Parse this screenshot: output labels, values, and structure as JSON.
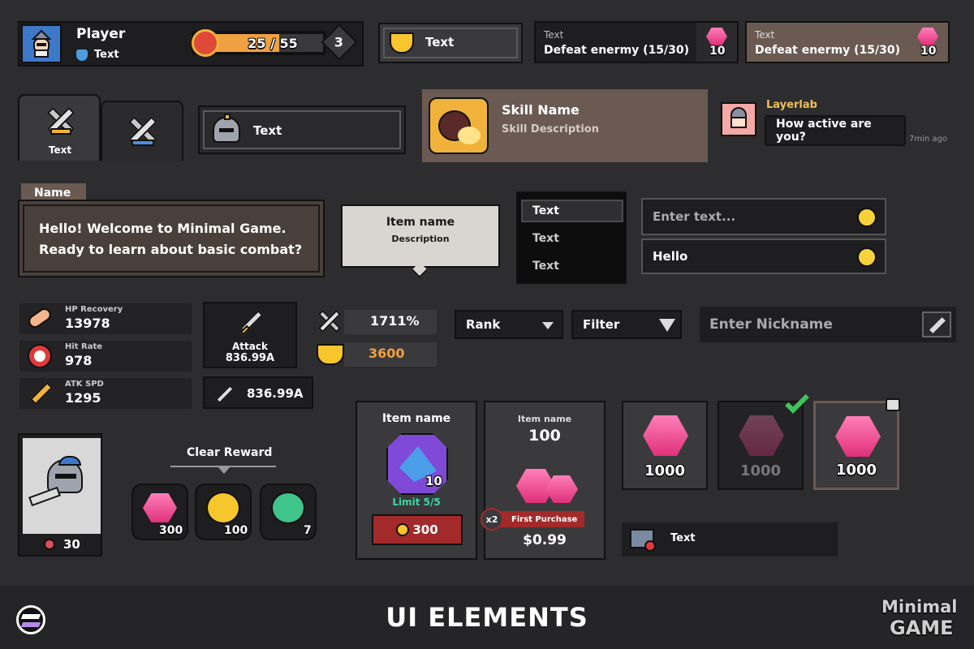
{
  "profile": {
    "name": "Player",
    "sub": "Text",
    "xp": "25 / 55",
    "level": "3"
  },
  "trophy_button": {
    "label": "Text"
  },
  "quest1": {
    "title": "Text",
    "desc": "Defeat enermy (15/30)",
    "reward": "10"
  },
  "quest2": {
    "title": "Text",
    "desc": "Defeat enermy (15/30)",
    "reward": "10"
  },
  "tabs": [
    {
      "label": "Text"
    },
    {
      "label": ""
    }
  ],
  "helmet_button": {
    "label": "Text"
  },
  "skill": {
    "name": "Skill Name",
    "desc": "Skill Description"
  },
  "chat": {
    "user": "Layerlab",
    "message": "How active are you?",
    "time": "7min ago"
  },
  "dialog": {
    "name": "Name",
    "line1": "Hello! Welcome to Minimal Game.",
    "line2": "Ready to learn about basic combat?"
  },
  "tooltip": {
    "title": "Item name",
    "desc": "Description"
  },
  "list": {
    "items": [
      "Text",
      "Text",
      "Text"
    ]
  },
  "inputs": {
    "placeholder": "Enter text...",
    "value": "Hello"
  },
  "stats": [
    {
      "label": "HP Recovery",
      "value": "13978"
    },
    {
      "label": "Hit Rate",
      "value": "978"
    },
    {
      "label": "ATK SPD",
      "value": "1295"
    }
  ],
  "attack_card": {
    "label": "Attack",
    "value": "836.99A"
  },
  "attack_small": {
    "value": "836.99A"
  },
  "power_pill": {
    "value": "1711%"
  },
  "trophy_pill": {
    "value": "3600"
  },
  "dropdowns": {
    "rank": "Rank",
    "filter": "Filter"
  },
  "nickname": {
    "placeholder": "Enter Nickname"
  },
  "character": {
    "count": "30"
  },
  "clear_reward": {
    "title": "Clear Reward",
    "items": [
      {
        "icon": "gem-icon",
        "count": "300"
      },
      {
        "icon": "coin-icon",
        "count": "100"
      },
      {
        "icon": "orb-icon",
        "count": "7"
      }
    ]
  },
  "shop1": {
    "title": "Item name",
    "qty": "10",
    "limit": "Limit 5/5",
    "price": "300"
  },
  "shop2": {
    "title": "Item name",
    "amount": "100",
    "multiplier": "x2",
    "badge": "First Purchase",
    "price": "$0.99"
  },
  "gem_slots": [
    {
      "value": "1000"
    },
    {
      "value": "1000"
    },
    {
      "value": "1000"
    }
  ],
  "video_row": {
    "label": "Text"
  },
  "footer": {
    "title": "UI ELEMENTS",
    "brand1": "Minimal",
    "brand2": "GAME"
  },
  "colors": {
    "bg": "#2d2d2f",
    "accent_orange": "#f0a040",
    "gem_pink": "#ee3f8a",
    "price_red": "#a32a2a",
    "limit_green": "#3fd6a0"
  }
}
